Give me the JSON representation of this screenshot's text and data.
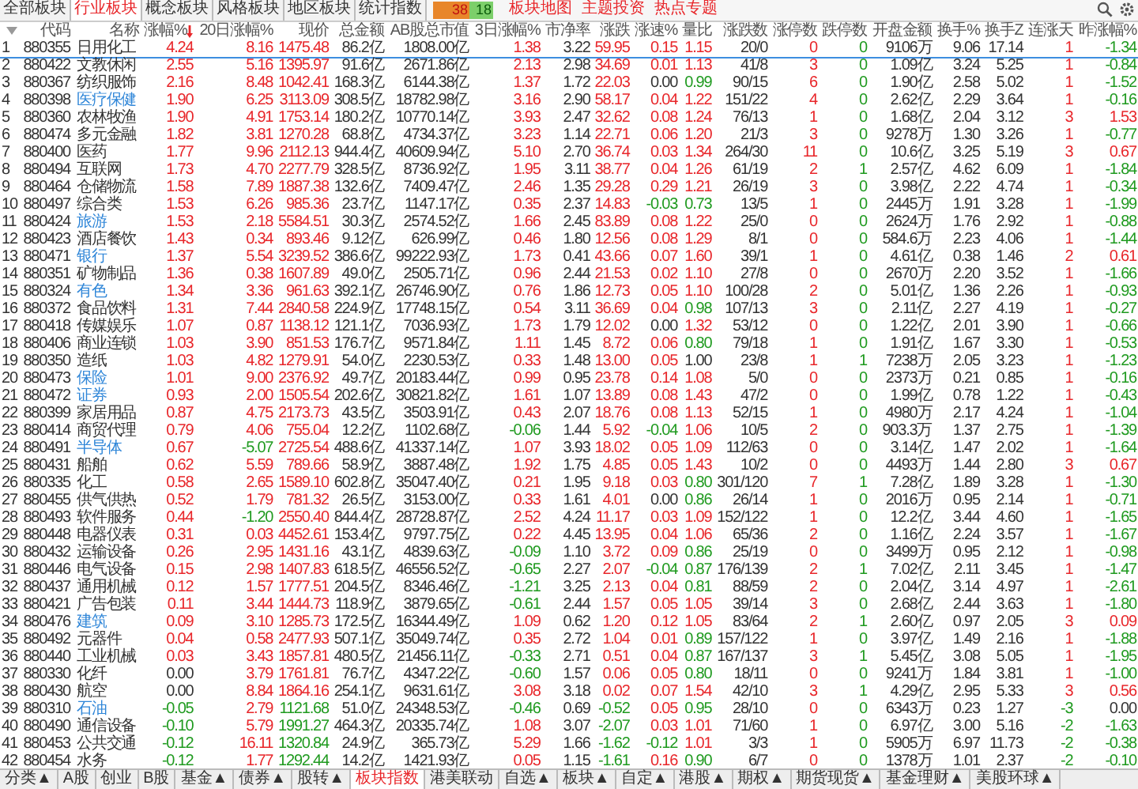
{
  "top_tabs": [
    {
      "label": "全部板块",
      "selected": false
    },
    {
      "label": "行业板块",
      "selected": true
    },
    {
      "label": "概念板块",
      "selected": false
    },
    {
      "label": "风格板块",
      "selected": false
    },
    {
      "label": "地区板块",
      "selected": false
    },
    {
      "label": "统计指数",
      "selected": false
    }
  ],
  "breadth": {
    "up": "38",
    "down": "18"
  },
  "links": [
    "板块地图",
    "主题投资",
    "热点专题"
  ],
  "columns": [
    {
      "kind": "plain"
    },
    {
      "label": "代码",
      "sorted": false,
      "kind": "plain"
    },
    {
      "label": "名称",
      "sorted": false,
      "kind": "plain"
    },
    {
      "label": "涨幅%",
      "sorted": true,
      "kind": "sign"
    },
    {
      "label": "20日涨幅%",
      "sorted": false,
      "kind": "sign"
    },
    {
      "label": "现价",
      "sorted": false,
      "kind": "price"
    },
    {
      "label": "总金额",
      "sorted": false,
      "kind": "plain"
    },
    {
      "label": "AB股总市值",
      "sorted": false,
      "kind": "plain"
    },
    {
      "label": "3日涨幅%",
      "sorted": false,
      "kind": "sign"
    },
    {
      "label": "市净率",
      "sorted": false,
      "kind": "plain"
    },
    {
      "label": "涨跌",
      "sorted": false,
      "kind": "sign"
    },
    {
      "label": "涨速%",
      "sorted": false,
      "kind": "sign"
    },
    {
      "label": "量比",
      "sorted": false,
      "kind": "ratio"
    },
    {
      "label": "涨跌数",
      "sorted": false,
      "kind": "plain"
    },
    {
      "label": "涨停数",
      "sorted": false,
      "kind": "up"
    },
    {
      "label": "跌停数",
      "sorted": false,
      "kind": "down"
    },
    {
      "label": "开盘金额",
      "sorted": false,
      "kind": "plain"
    },
    {
      "label": "换手%",
      "sorted": false,
      "kind": "plain"
    },
    {
      "label": "换手Z",
      "sorted": false,
      "kind": "plain"
    },
    {
      "label": "连涨天",
      "sorted": false,
      "kind": "sign"
    },
    {
      "label": "昨涨幅%",
      "sorted": false,
      "kind": "sign"
    }
  ],
  "rows": [
    {
      "selected": true,
      "highlighted": false,
      "cells": [
        "1",
        "880355",
        "日用化工",
        "4.24",
        "8.16",
        "1475.48",
        "86.2亿",
        "1808.00亿",
        "1.38",
        "3.22",
        "59.95",
        "0.15",
        "1.15",
        "20/0",
        "0",
        "0",
        "9106万",
        "9.06",
        "17.14",
        "1",
        "-1.34"
      ]
    },
    {
      "selected": false,
      "highlighted": false,
      "cells": [
        "2",
        "880422",
        "文教休闲",
        "2.55",
        "5.16",
        "1395.97",
        "91.6亿",
        "2671.86亿",
        "2.13",
        "2.98",
        "34.69",
        "0.01",
        "1.13",
        "41/8",
        "3",
        "0",
        "1.09亿",
        "3.24",
        "5.25",
        "1",
        "-0.84"
      ]
    },
    {
      "selected": false,
      "highlighted": false,
      "cells": [
        "3",
        "880367",
        "纺织服饰",
        "2.16",
        "8.48",
        "1042.41",
        "168.3亿",
        "6144.38亿",
        "1.37",
        "1.72",
        "22.03",
        "0.00",
        "0.99",
        "90/15",
        "6",
        "0",
        "1.90亿",
        "2.58",
        "5.02",
        "1",
        "-1.52"
      ]
    },
    {
      "selected": false,
      "highlighted": true,
      "cells": [
        "4",
        "880398",
        "医疗保健",
        "1.90",
        "6.25",
        "3113.09",
        "308.5亿",
        "18782.98亿",
        "3.16",
        "2.90",
        "58.17",
        "0.04",
        "1.22",
        "151/22",
        "4",
        "0",
        "2.62亿",
        "2.29",
        "3.64",
        "1",
        "-0.16"
      ]
    },
    {
      "selected": false,
      "highlighted": false,
      "cells": [
        "5",
        "880360",
        "农林牧渔",
        "1.90",
        "4.91",
        "1753.14",
        "180.2亿",
        "10770.14亿",
        "3.93",
        "2.47",
        "32.62",
        "0.08",
        "1.24",
        "76/13",
        "1",
        "0",
        "1.68亿",
        "2.04",
        "3.12",
        "3",
        "1.53"
      ]
    },
    {
      "selected": false,
      "highlighted": false,
      "cells": [
        "6",
        "880474",
        "多元金融",
        "1.82",
        "3.81",
        "1270.28",
        "68.8亿",
        "4734.37亿",
        "3.23",
        "1.14",
        "22.71",
        "0.06",
        "1.20",
        "21/3",
        "3",
        "0",
        "9278万",
        "1.30",
        "3.26",
        "1",
        "-0.77"
      ]
    },
    {
      "selected": false,
      "highlighted": false,
      "cells": [
        "7",
        "880400",
        "医药",
        "1.77",
        "9.96",
        "2112.13",
        "944.4亿",
        "40609.94亿",
        "5.10",
        "2.70",
        "36.74",
        "0.03",
        "1.34",
        "264/30",
        "11",
        "0",
        "10.6亿",
        "3.25",
        "5.19",
        "3",
        "0.67"
      ]
    },
    {
      "selected": false,
      "highlighted": false,
      "cells": [
        "8",
        "880494",
        "互联网",
        "1.73",
        "4.70",
        "2277.79",
        "328.5亿",
        "8736.92亿",
        "1.95",
        "3.11",
        "38.77",
        "0.04",
        "1.26",
        "61/19",
        "2",
        "1",
        "2.57亿",
        "4.62",
        "6.09",
        "1",
        "-1.84"
      ]
    },
    {
      "selected": false,
      "highlighted": false,
      "cells": [
        "9",
        "880464",
        "仓储物流",
        "1.58",
        "7.89",
        "1887.38",
        "132.6亿",
        "7409.47亿",
        "2.46",
        "1.35",
        "29.28",
        "0.29",
        "1.21",
        "26/19",
        "3",
        "0",
        "3.98亿",
        "2.22",
        "4.74",
        "1",
        "-0.34"
      ]
    },
    {
      "selected": false,
      "highlighted": false,
      "cells": [
        "10",
        "880497",
        "综合类",
        "1.53",
        "6.26",
        "985.36",
        "23.7亿",
        "1147.17亿",
        "0.35",
        "2.37",
        "14.83",
        "-0.03",
        "0.73",
        "13/5",
        "1",
        "0",
        "2445万",
        "1.91",
        "3.28",
        "1",
        "-1.99"
      ]
    },
    {
      "selected": false,
      "highlighted": true,
      "cells": [
        "11",
        "880424",
        "旅游",
        "1.53",
        "2.18",
        "5584.51",
        "30.3亿",
        "2574.52亿",
        "1.66",
        "2.45",
        "83.89",
        "0.08",
        "1.22",
        "25/0",
        "0",
        "0",
        "2624万",
        "1.76",
        "2.92",
        "1",
        "-0.88"
      ]
    },
    {
      "selected": false,
      "highlighted": false,
      "cells": [
        "12",
        "880423",
        "酒店餐饮",
        "1.43",
        "0.34",
        "893.46",
        "9.12亿",
        "626.99亿",
        "0.46",
        "1.80",
        "12.56",
        "0.08",
        "1.29",
        "8/1",
        "0",
        "0",
        "584.6万",
        "2.23",
        "4.06",
        "1",
        "-1.44"
      ]
    },
    {
      "selected": false,
      "highlighted": true,
      "cells": [
        "13",
        "880471",
        "银行",
        "1.37",
        "5.54",
        "3239.52",
        "386.6亿",
        "99222.93亿",
        "1.73",
        "0.41",
        "43.66",
        "0.07",
        "1.60",
        "39/1",
        "1",
        "0",
        "4.61亿",
        "0.38",
        "1.46",
        "2",
        "0.61"
      ]
    },
    {
      "selected": false,
      "highlighted": false,
      "cells": [
        "14",
        "880351",
        "矿物制品",
        "1.36",
        "0.38",
        "1607.89",
        "49.0亿",
        "2505.71亿",
        "0.96",
        "2.44",
        "21.53",
        "0.02",
        "1.10",
        "27/8",
        "0",
        "0",
        "2670万",
        "2.20",
        "3.52",
        "1",
        "-1.66"
      ]
    },
    {
      "selected": false,
      "highlighted": true,
      "cells": [
        "15",
        "880324",
        "有色",
        "1.34",
        "3.36",
        "961.63",
        "392.1亿",
        "26746.90亿",
        "0.76",
        "1.86",
        "12.73",
        "0.05",
        "1.10",
        "100/28",
        "2",
        "0",
        "5.01亿",
        "1.36",
        "2.26",
        "1",
        "-0.93"
      ]
    },
    {
      "selected": false,
      "highlighted": false,
      "cells": [
        "16",
        "880372",
        "食品饮料",
        "1.31",
        "7.44",
        "2840.58",
        "224.9亿",
        "17748.15亿",
        "0.54",
        "3.11",
        "36.69",
        "0.04",
        "0.98",
        "107/13",
        "3",
        "0",
        "2.11亿",
        "2.27",
        "4.19",
        "1",
        "-0.27"
      ]
    },
    {
      "selected": false,
      "highlighted": false,
      "cells": [
        "17",
        "880418",
        "传媒娱乐",
        "1.07",
        "0.87",
        "1138.12",
        "121.1亿",
        "7036.93亿",
        "1.73",
        "1.79",
        "12.02",
        "0.00",
        "1.32",
        "53/12",
        "0",
        "0",
        "1.22亿",
        "2.01",
        "3.90",
        "1",
        "-0.66"
      ]
    },
    {
      "selected": false,
      "highlighted": false,
      "cells": [
        "18",
        "880406",
        "商业连锁",
        "1.03",
        "3.90",
        "851.53",
        "176.7亿",
        "9571.84亿",
        "1.11",
        "1.45",
        "8.72",
        "0.06",
        "0.80",
        "79/18",
        "1",
        "0",
        "1.91亿",
        "1.67",
        "3.30",
        "1",
        "-0.53"
      ]
    },
    {
      "selected": false,
      "highlighted": false,
      "cells": [
        "19",
        "880350",
        "造纸",
        "1.03",
        "4.82",
        "1279.91",
        "54.0亿",
        "2230.53亿",
        "0.33",
        "1.48",
        "13.00",
        "0.05",
        "1.00",
        "23/8",
        "1",
        "1",
        "7238万",
        "2.05",
        "3.23",
        "1",
        "-1.23"
      ]
    },
    {
      "selected": false,
      "highlighted": true,
      "cells": [
        "20",
        "880473",
        "保险",
        "1.01",
        "9.00",
        "2376.92",
        "49.7亿",
        "20183.44亿",
        "0.99",
        "0.95",
        "23.78",
        "0.14",
        "1.08",
        "5/0",
        "0",
        "0",
        "2373万",
        "0.21",
        "0.85",
        "1",
        "-0.16"
      ]
    },
    {
      "selected": false,
      "highlighted": true,
      "cells": [
        "21",
        "880472",
        "证券",
        "0.93",
        "2.00",
        "1505.54",
        "202.6亿",
        "30821.82亿",
        "1.61",
        "1.07",
        "13.89",
        "0.08",
        "1.43",
        "47/2",
        "0",
        "0",
        "1.99亿",
        "0.78",
        "1.22",
        "1",
        "-0.43"
      ]
    },
    {
      "selected": false,
      "highlighted": false,
      "cells": [
        "22",
        "880399",
        "家居用品",
        "0.87",
        "4.75",
        "2173.73",
        "43.5亿",
        "3503.91亿",
        "0.43",
        "2.07",
        "18.76",
        "0.08",
        "1.13",
        "52/15",
        "1",
        "0",
        "4980万",
        "2.17",
        "4.24",
        "1",
        "-1.04"
      ]
    },
    {
      "selected": false,
      "highlighted": false,
      "cells": [
        "23",
        "880414",
        "商贸代理",
        "0.79",
        "4.06",
        "755.04",
        "12.2亿",
        "1102.68亿",
        "-0.06",
        "1.44",
        "5.92",
        "-0.04",
        "1.06",
        "10/5",
        "2",
        "0",
        "903.3万",
        "1.37",
        "2.75",
        "1",
        "-1.39"
      ]
    },
    {
      "selected": false,
      "highlighted": true,
      "cells": [
        "24",
        "880491",
        "半导体",
        "0.67",
        "-5.07",
        "2725.54",
        "488.6亿",
        "41337.14亿",
        "1.07",
        "3.93",
        "18.02",
        "0.05",
        "1.09",
        "112/63",
        "0",
        "0",
        "3.14亿",
        "1.47",
        "2.02",
        "1",
        "-1.64"
      ]
    },
    {
      "selected": false,
      "highlighted": false,
      "cells": [
        "25",
        "880431",
        "船舶",
        "0.62",
        "5.59",
        "789.66",
        "58.9亿",
        "3887.48亿",
        "1.92",
        "1.75",
        "4.85",
        "0.05",
        "1.43",
        "10/2",
        "0",
        "0",
        "4493万",
        "1.44",
        "2.80",
        "3",
        "0.67"
      ]
    },
    {
      "selected": false,
      "highlighted": false,
      "cells": [
        "26",
        "880335",
        "化工",
        "0.58",
        "2.65",
        "1589.10",
        "602.8亿",
        "35047.40亿",
        "0.21",
        "1.95",
        "9.18",
        "0.03",
        "0.80",
        "301/120",
        "7",
        "1",
        "7.28亿",
        "1.89",
        "3.28",
        "1",
        "-1.30"
      ]
    },
    {
      "selected": false,
      "highlighted": false,
      "cells": [
        "27",
        "880455",
        "供气供热",
        "0.52",
        "1.79",
        "781.32",
        "26.5亿",
        "3153.00亿",
        "0.33",
        "1.61",
        "4.01",
        "0.00",
        "0.86",
        "26/14",
        "1",
        "0",
        "2016万",
        "0.95",
        "2.14",
        "1",
        "-0.71"
      ]
    },
    {
      "selected": false,
      "highlighted": false,
      "cells": [
        "28",
        "880493",
        "软件服务",
        "0.44",
        "-1.20",
        "2550.40",
        "844.4亿",
        "28728.87亿",
        "2.52",
        "4.24",
        "11.17",
        "0.03",
        "1.09",
        "152/122",
        "1",
        "0",
        "12.2亿",
        "3.44",
        "4.60",
        "1",
        "-1.65"
      ]
    },
    {
      "selected": false,
      "highlighted": false,
      "cells": [
        "29",
        "880448",
        "电器仪表",
        "0.31",
        "0.03",
        "4452.61",
        "153.4亿",
        "9797.75亿",
        "0.22",
        "4.45",
        "13.95",
        "0.04",
        "1.06",
        "65/36",
        "2",
        "0",
        "1.16亿",
        "2.24",
        "3.57",
        "1",
        "-1.67"
      ]
    },
    {
      "selected": false,
      "highlighted": false,
      "cells": [
        "30",
        "880432",
        "运输设备",
        "0.26",
        "2.95",
        "1431.16",
        "43.1亿",
        "4839.63亿",
        "-0.09",
        "1.10",
        "3.72",
        "0.09",
        "0.86",
        "25/19",
        "0",
        "0",
        "3499万",
        "0.95",
        "2.12",
        "1",
        "-0.98"
      ]
    },
    {
      "selected": false,
      "highlighted": false,
      "cells": [
        "31",
        "880446",
        "电气设备",
        "0.15",
        "2.98",
        "1407.83",
        "618.5亿",
        "46556.52亿",
        "-0.65",
        "2.27",
        "2.07",
        "-0.04",
        "0.87",
        "176/139",
        "2",
        "1",
        "7.02亿",
        "2.11",
        "3.45",
        "1",
        "-1.47"
      ]
    },
    {
      "selected": false,
      "highlighted": false,
      "cells": [
        "32",
        "880437",
        "通用机械",
        "0.12",
        "1.57",
        "1777.51",
        "204.5亿",
        "8346.46亿",
        "-1.21",
        "3.25",
        "2.13",
        "0.04",
        "0.81",
        "88/59",
        "2",
        "0",
        "2.04亿",
        "3.14",
        "4.97",
        "1",
        "-2.61"
      ]
    },
    {
      "selected": false,
      "highlighted": false,
      "cells": [
        "33",
        "880421",
        "广告包装",
        "0.11",
        "3.44",
        "1444.73",
        "118.9亿",
        "3879.65亿",
        "-0.61",
        "2.44",
        "1.57",
        "0.05",
        "1.05",
        "39/14",
        "3",
        "0",
        "2.68亿",
        "2.44",
        "3.63",
        "1",
        "-1.80"
      ]
    },
    {
      "selected": false,
      "highlighted": true,
      "cells": [
        "34",
        "880476",
        "建筑",
        "0.09",
        "3.10",
        "1285.73",
        "172.5亿",
        "16344.49亿",
        "1.09",
        "0.62",
        "1.20",
        "0.12",
        "1.05",
        "83/64",
        "2",
        "1",
        "2.60亿",
        "0.97",
        "2.05",
        "3",
        "0.09"
      ]
    },
    {
      "selected": false,
      "highlighted": false,
      "cells": [
        "35",
        "880492",
        "元器件",
        "0.04",
        "0.58",
        "2477.93",
        "507.1亿",
        "35049.74亿",
        "0.35",
        "2.72",
        "1.04",
        "0.01",
        "0.89",
        "157/122",
        "1",
        "0",
        "3.97亿",
        "1.49",
        "2.16",
        "1",
        "-1.88"
      ]
    },
    {
      "selected": false,
      "highlighted": false,
      "cells": [
        "36",
        "880440",
        "工业机械",
        "0.03",
        "3.43",
        "1857.81",
        "480.5亿",
        "21456.11亿",
        "-0.33",
        "2.71",
        "0.51",
        "0.04",
        "0.87",
        "167/137",
        "3",
        "1",
        "5.45亿",
        "3.08",
        "5.05",
        "1",
        "-1.95"
      ]
    },
    {
      "selected": false,
      "highlighted": false,
      "cells": [
        "37",
        "880330",
        "化纤",
        "0.00",
        "3.79",
        "1761.81",
        "76.7亿",
        "4347.22亿",
        "-0.60",
        "1.57",
        "0.06",
        "0.05",
        "0.80",
        "18/11",
        "0",
        "0",
        "9241万",
        "1.84",
        "3.81",
        "1",
        "-1.00"
      ]
    },
    {
      "selected": false,
      "highlighted": false,
      "cells": [
        "38",
        "880430",
        "航空",
        "0.00",
        "8.84",
        "1864.16",
        "254.1亿",
        "9631.61亿",
        "3.08",
        "3.18",
        "0.02",
        "0.07",
        "1.54",
        "42/10",
        "3",
        "1",
        "4.29亿",
        "2.95",
        "5.33",
        "3",
        "0.56"
      ]
    },
    {
      "selected": false,
      "highlighted": true,
      "cells": [
        "39",
        "880310",
        "石油",
        "-0.05",
        "2.79",
        "1121.68",
        "51.0亿",
        "24348.53亿",
        "-0.46",
        "0.69",
        "-0.52",
        "0.05",
        "0.95",
        "28/10",
        "0",
        "0",
        "6343万",
        "0.23",
        "1.27",
        "-3",
        "0.00"
      ]
    },
    {
      "selected": false,
      "highlighted": false,
      "cells": [
        "40",
        "880490",
        "通信设备",
        "-0.10",
        "5.79",
        "1991.27",
        "464.3亿",
        "20335.74亿",
        "1.08",
        "3.07",
        "-2.07",
        "0.03",
        "1.01",
        "71/60",
        "1",
        "0",
        "6.97亿",
        "3.00",
        "5.16",
        "-2",
        "-1.63"
      ]
    },
    {
      "selected": false,
      "highlighted": false,
      "cells": [
        "41",
        "880453",
        "公共交通",
        "-0.12",
        "16.11",
        "1320.84",
        "24.9亿",
        "365.73亿",
        "5.29",
        "1.66",
        "-1.62",
        "-0.12",
        "1.01",
        "3/3",
        "1",
        "0",
        "5905万",
        "6.97",
        "11.73",
        "-2",
        "-0.38"
      ]
    },
    {
      "selected": false,
      "highlighted": false,
      "cells": [
        "42",
        "880454",
        "水务",
        "-0.12",
        "1.77",
        "1292.44",
        "14.2亿",
        "1421.93亿",
        "0.05",
        "1.15",
        "-1.61",
        "0.16",
        "0.90",
        "6/7",
        "0",
        "0",
        "1378万",
        "1.01",
        "2.37",
        "-2",
        "-0.10"
      ]
    }
  ],
  "bottom_tabs": [
    {
      "label": "分类▲",
      "selected": false
    },
    {
      "label": "A股",
      "selected": false
    },
    {
      "label": "创业",
      "selected": false
    },
    {
      "label": "B股",
      "selected": false
    },
    {
      "label": "基金▲",
      "selected": false
    },
    {
      "label": "债券▲",
      "selected": false
    },
    {
      "label": "股转▲",
      "selected": false
    },
    {
      "label": "板块指数",
      "selected": true
    },
    {
      "label": "港美联动",
      "selected": false
    },
    {
      "label": "自选▲",
      "selected": false
    },
    {
      "label": "板块▲",
      "selected": false
    },
    {
      "label": "自定▲",
      "selected": false
    },
    {
      "label": "港股▲",
      "selected": false
    },
    {
      "label": "期权▲",
      "selected": false
    },
    {
      "label": "期货现货▲",
      "selected": false
    },
    {
      "label": "基金理财▲",
      "selected": false
    },
    {
      "label": "美股环球▲",
      "selected": false
    }
  ]
}
